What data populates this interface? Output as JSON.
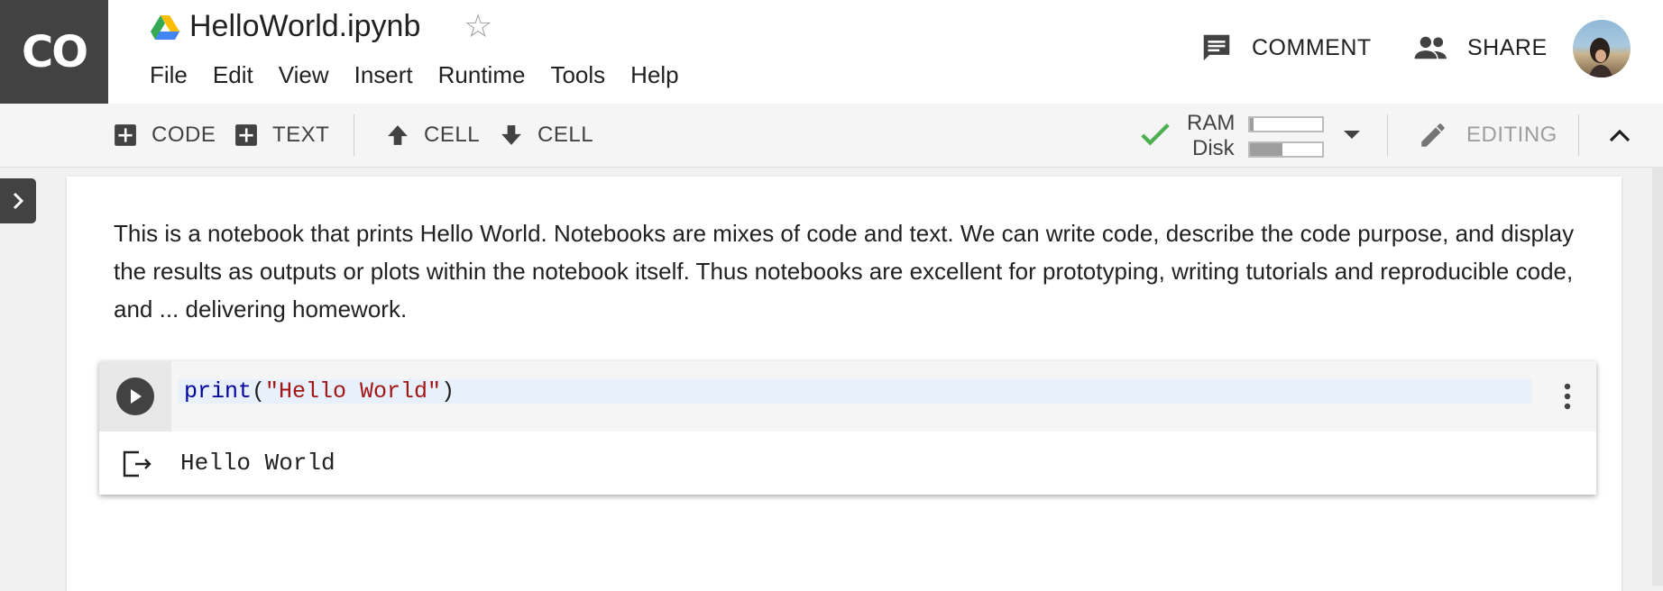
{
  "app": {
    "logo_text": "CO",
    "title": "HelloWorld.ipynb"
  },
  "menu": [
    "File",
    "Edit",
    "View",
    "Insert",
    "Runtime",
    "Tools",
    "Help"
  ],
  "header_actions": {
    "comment_label": "COMMENT",
    "share_label": "SHARE"
  },
  "toolbar": {
    "add_code_label": "CODE",
    "add_text_label": "TEXT",
    "cell_up_label": "CELL",
    "cell_down_label": "CELL",
    "ram_label": "RAM",
    "disk_label": "Disk",
    "ram_usage": 0.05,
    "disk_usage": 0.45,
    "editing_label": "EDITING"
  },
  "notebook": {
    "text_cell": "This is a notebook that prints Hello World. Notebooks are mixes of code and text. We can write code, describe the code purpose, and display the results as outputs or plots within the notebook itself. Thus notebooks are excellent for prototyping, writing tutorials and reproducible code, and ... delivering homework.",
    "code_cell": {
      "func": "print",
      "open_paren": "(",
      "string_arg": "\"Hello World\"",
      "close_paren": ")",
      "output": "Hello World"
    }
  },
  "colors": {
    "logo_bg": "#424242",
    "connected_check": "#4caf50",
    "code_keyword": "#0000a0",
    "code_string": "#a31515"
  },
  "icons": [
    "drive-icon",
    "star-icon",
    "comment-icon",
    "people-icon",
    "add-box-icon",
    "arrow-up-icon",
    "arrow-down-icon",
    "check-icon",
    "dropdown-arrow-icon",
    "pencil-icon",
    "chevron-up-icon",
    "chevron-right-icon",
    "play-icon",
    "more-vert-icon",
    "output-icon"
  ]
}
